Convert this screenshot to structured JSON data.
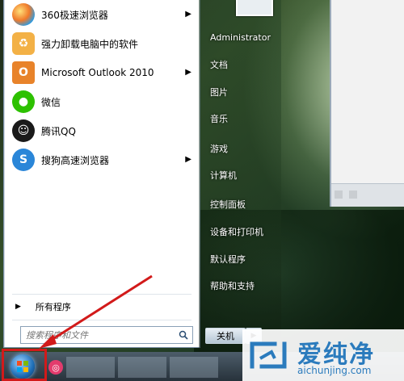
{
  "programs": [
    {
      "label": "360极速浏览器",
      "icon": "360-browser-icon",
      "color": "#e8483a",
      "has_arrow": true
    },
    {
      "label": "强力卸载电脑中的软件",
      "icon": "uninstall-icon",
      "color": "#f0a63a",
      "has_arrow": false
    },
    {
      "label": "Microsoft Outlook 2010",
      "icon": "outlook-icon",
      "color": "#e8832a",
      "has_arrow": true
    },
    {
      "label": "微信",
      "icon": "wechat-icon",
      "color": "#2dc100",
      "has_arrow": false
    },
    {
      "label": "腾讯QQ",
      "icon": "qq-icon",
      "color": "#1a1a1a",
      "has_arrow": false
    },
    {
      "label": "搜狗高速浏览器",
      "icon": "sogou-browser-icon",
      "color": "#2a86d8",
      "has_arrow": true
    }
  ],
  "all_programs": "所有程序",
  "search": {
    "placeholder": "搜索程序和文件"
  },
  "right_items": [
    {
      "label": "Administrator",
      "has_arrow": false
    },
    {
      "label": "文档",
      "has_arrow": false
    },
    {
      "label": "图片",
      "has_arrow": false
    },
    {
      "label": "音乐",
      "has_arrow": false
    },
    {
      "label": "游戏",
      "has_arrow": false
    },
    {
      "label": "计算机",
      "has_arrow": false
    },
    {
      "label": "控制面板",
      "has_arrow": false
    },
    {
      "label": "设备和打印机",
      "has_arrow": false
    },
    {
      "label": "默认程序",
      "has_arrow": false
    },
    {
      "label": "帮助和支持",
      "has_arrow": false
    }
  ],
  "shutdown_label": "关机",
  "watermark": {
    "cn": "爱纯净",
    "url": "aichunjing.com"
  },
  "colors": {
    "highlight": "#d21a1a",
    "brand": "#2b7bbd"
  }
}
